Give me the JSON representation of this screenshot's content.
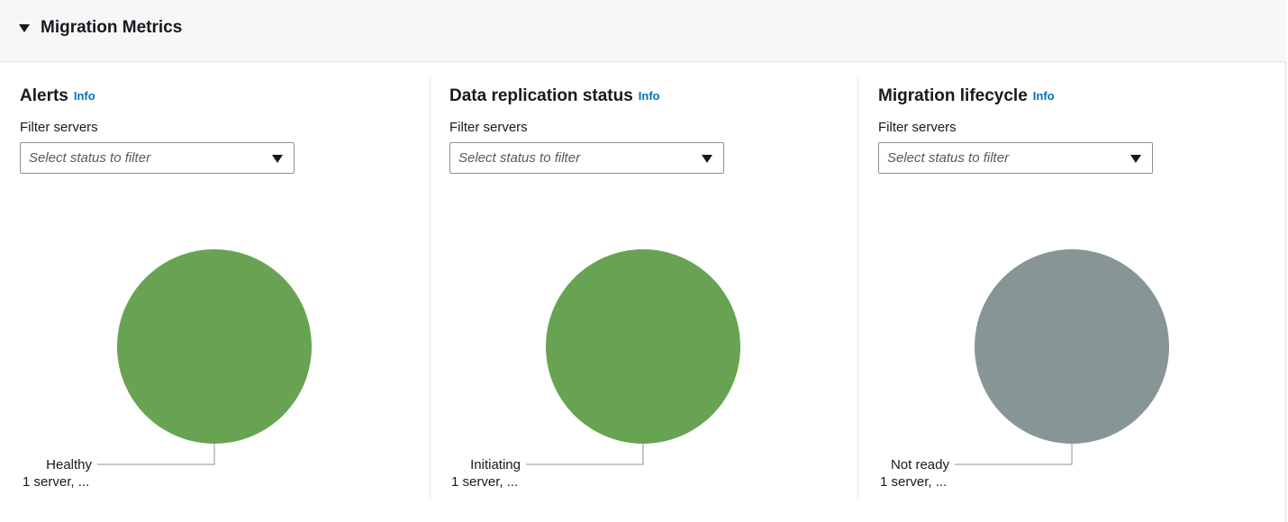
{
  "section": {
    "title": "Migration Metrics"
  },
  "panels": [
    {
      "title": "Alerts",
      "info": "Info",
      "filter_label": "Filter servers",
      "filter_placeholder": "Select status to filter",
      "segment": {
        "label": "Healthy",
        "detail": "1 server, ...",
        "color": "#67a353",
        "value": 1
      }
    },
    {
      "title": "Data replication status",
      "info": "Info",
      "filter_label": "Filter servers",
      "filter_placeholder": "Select status to filter",
      "segment": {
        "label": "Initiating",
        "detail": "1 server, ...",
        "color": "#67a353",
        "value": 1
      }
    },
    {
      "title": "Migration lifecycle",
      "info": "Info",
      "filter_label": "Filter servers",
      "filter_placeholder": "Select status to filter",
      "segment": {
        "label": "Not ready",
        "detail": "1 server, ...",
        "color": "#879596",
        "value": 1
      }
    }
  ]
}
